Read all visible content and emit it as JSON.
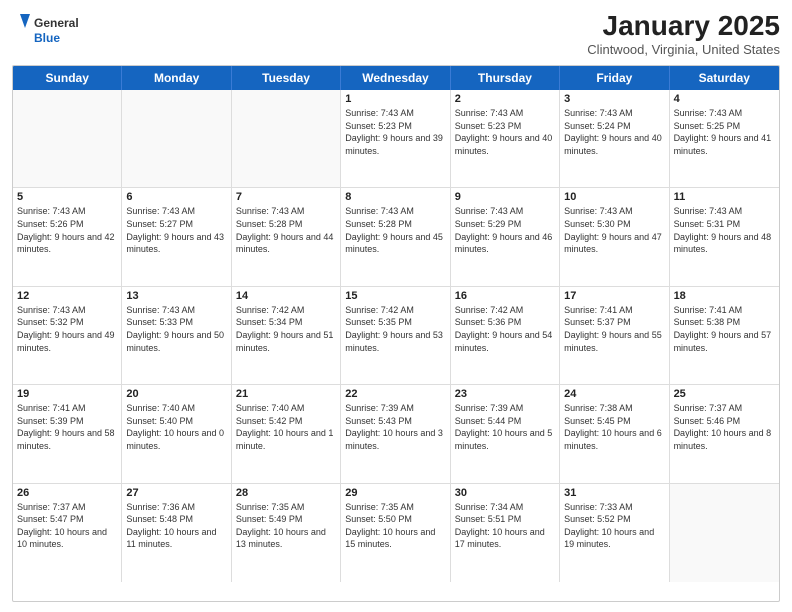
{
  "header": {
    "logo_general": "General",
    "logo_blue": "Blue",
    "month": "January 2025",
    "location": "Clintwood, Virginia, United States"
  },
  "days_of_week": [
    "Sunday",
    "Monday",
    "Tuesday",
    "Wednesday",
    "Thursday",
    "Friday",
    "Saturday"
  ],
  "weeks": [
    [
      {
        "date": "",
        "sunrise": "",
        "sunset": "",
        "daylight": "",
        "empty": true
      },
      {
        "date": "",
        "sunrise": "",
        "sunset": "",
        "daylight": "",
        "empty": true
      },
      {
        "date": "",
        "sunrise": "",
        "sunset": "",
        "daylight": "",
        "empty": true
      },
      {
        "date": "1",
        "sunrise": "Sunrise: 7:43 AM",
        "sunset": "Sunset: 5:23 PM",
        "daylight": "Daylight: 9 hours and 39 minutes.",
        "empty": false
      },
      {
        "date": "2",
        "sunrise": "Sunrise: 7:43 AM",
        "sunset": "Sunset: 5:23 PM",
        "daylight": "Daylight: 9 hours and 40 minutes.",
        "empty": false
      },
      {
        "date": "3",
        "sunrise": "Sunrise: 7:43 AM",
        "sunset": "Sunset: 5:24 PM",
        "daylight": "Daylight: 9 hours and 40 minutes.",
        "empty": false
      },
      {
        "date": "4",
        "sunrise": "Sunrise: 7:43 AM",
        "sunset": "Sunset: 5:25 PM",
        "daylight": "Daylight: 9 hours and 41 minutes.",
        "empty": false
      }
    ],
    [
      {
        "date": "5",
        "sunrise": "Sunrise: 7:43 AM",
        "sunset": "Sunset: 5:26 PM",
        "daylight": "Daylight: 9 hours and 42 minutes.",
        "empty": false
      },
      {
        "date": "6",
        "sunrise": "Sunrise: 7:43 AM",
        "sunset": "Sunset: 5:27 PM",
        "daylight": "Daylight: 9 hours and 43 minutes.",
        "empty": false
      },
      {
        "date": "7",
        "sunrise": "Sunrise: 7:43 AM",
        "sunset": "Sunset: 5:28 PM",
        "daylight": "Daylight: 9 hours and 44 minutes.",
        "empty": false
      },
      {
        "date": "8",
        "sunrise": "Sunrise: 7:43 AM",
        "sunset": "Sunset: 5:28 PM",
        "daylight": "Daylight: 9 hours and 45 minutes.",
        "empty": false
      },
      {
        "date": "9",
        "sunrise": "Sunrise: 7:43 AM",
        "sunset": "Sunset: 5:29 PM",
        "daylight": "Daylight: 9 hours and 46 minutes.",
        "empty": false
      },
      {
        "date": "10",
        "sunrise": "Sunrise: 7:43 AM",
        "sunset": "Sunset: 5:30 PM",
        "daylight": "Daylight: 9 hours and 47 minutes.",
        "empty": false
      },
      {
        "date": "11",
        "sunrise": "Sunrise: 7:43 AM",
        "sunset": "Sunset: 5:31 PM",
        "daylight": "Daylight: 9 hours and 48 minutes.",
        "empty": false
      }
    ],
    [
      {
        "date": "12",
        "sunrise": "Sunrise: 7:43 AM",
        "sunset": "Sunset: 5:32 PM",
        "daylight": "Daylight: 9 hours and 49 minutes.",
        "empty": false
      },
      {
        "date": "13",
        "sunrise": "Sunrise: 7:43 AM",
        "sunset": "Sunset: 5:33 PM",
        "daylight": "Daylight: 9 hours and 50 minutes.",
        "empty": false
      },
      {
        "date": "14",
        "sunrise": "Sunrise: 7:42 AM",
        "sunset": "Sunset: 5:34 PM",
        "daylight": "Daylight: 9 hours and 51 minutes.",
        "empty": false
      },
      {
        "date": "15",
        "sunrise": "Sunrise: 7:42 AM",
        "sunset": "Sunset: 5:35 PM",
        "daylight": "Daylight: 9 hours and 53 minutes.",
        "empty": false
      },
      {
        "date": "16",
        "sunrise": "Sunrise: 7:42 AM",
        "sunset": "Sunset: 5:36 PM",
        "daylight": "Daylight: 9 hours and 54 minutes.",
        "empty": false
      },
      {
        "date": "17",
        "sunrise": "Sunrise: 7:41 AM",
        "sunset": "Sunset: 5:37 PM",
        "daylight": "Daylight: 9 hours and 55 minutes.",
        "empty": false
      },
      {
        "date": "18",
        "sunrise": "Sunrise: 7:41 AM",
        "sunset": "Sunset: 5:38 PM",
        "daylight": "Daylight: 9 hours and 57 minutes.",
        "empty": false
      }
    ],
    [
      {
        "date": "19",
        "sunrise": "Sunrise: 7:41 AM",
        "sunset": "Sunset: 5:39 PM",
        "daylight": "Daylight: 9 hours and 58 minutes.",
        "empty": false
      },
      {
        "date": "20",
        "sunrise": "Sunrise: 7:40 AM",
        "sunset": "Sunset: 5:40 PM",
        "daylight": "Daylight: 10 hours and 0 minutes.",
        "empty": false
      },
      {
        "date": "21",
        "sunrise": "Sunrise: 7:40 AM",
        "sunset": "Sunset: 5:42 PM",
        "daylight": "Daylight: 10 hours and 1 minute.",
        "empty": false
      },
      {
        "date": "22",
        "sunrise": "Sunrise: 7:39 AM",
        "sunset": "Sunset: 5:43 PM",
        "daylight": "Daylight: 10 hours and 3 minutes.",
        "empty": false
      },
      {
        "date": "23",
        "sunrise": "Sunrise: 7:39 AM",
        "sunset": "Sunset: 5:44 PM",
        "daylight": "Daylight: 10 hours and 5 minutes.",
        "empty": false
      },
      {
        "date": "24",
        "sunrise": "Sunrise: 7:38 AM",
        "sunset": "Sunset: 5:45 PM",
        "daylight": "Daylight: 10 hours and 6 minutes.",
        "empty": false
      },
      {
        "date": "25",
        "sunrise": "Sunrise: 7:37 AM",
        "sunset": "Sunset: 5:46 PM",
        "daylight": "Daylight: 10 hours and 8 minutes.",
        "empty": false
      }
    ],
    [
      {
        "date": "26",
        "sunrise": "Sunrise: 7:37 AM",
        "sunset": "Sunset: 5:47 PM",
        "daylight": "Daylight: 10 hours and 10 minutes.",
        "empty": false
      },
      {
        "date": "27",
        "sunrise": "Sunrise: 7:36 AM",
        "sunset": "Sunset: 5:48 PM",
        "daylight": "Daylight: 10 hours and 11 minutes.",
        "empty": false
      },
      {
        "date": "28",
        "sunrise": "Sunrise: 7:35 AM",
        "sunset": "Sunset: 5:49 PM",
        "daylight": "Daylight: 10 hours and 13 minutes.",
        "empty": false
      },
      {
        "date": "29",
        "sunrise": "Sunrise: 7:35 AM",
        "sunset": "Sunset: 5:50 PM",
        "daylight": "Daylight: 10 hours and 15 minutes.",
        "empty": false
      },
      {
        "date": "30",
        "sunrise": "Sunrise: 7:34 AM",
        "sunset": "Sunset: 5:51 PM",
        "daylight": "Daylight: 10 hours and 17 minutes.",
        "empty": false
      },
      {
        "date": "31",
        "sunrise": "Sunrise: 7:33 AM",
        "sunset": "Sunset: 5:52 PM",
        "daylight": "Daylight: 10 hours and 19 minutes.",
        "empty": false
      },
      {
        "date": "",
        "sunrise": "",
        "sunset": "",
        "daylight": "",
        "empty": true
      }
    ]
  ]
}
